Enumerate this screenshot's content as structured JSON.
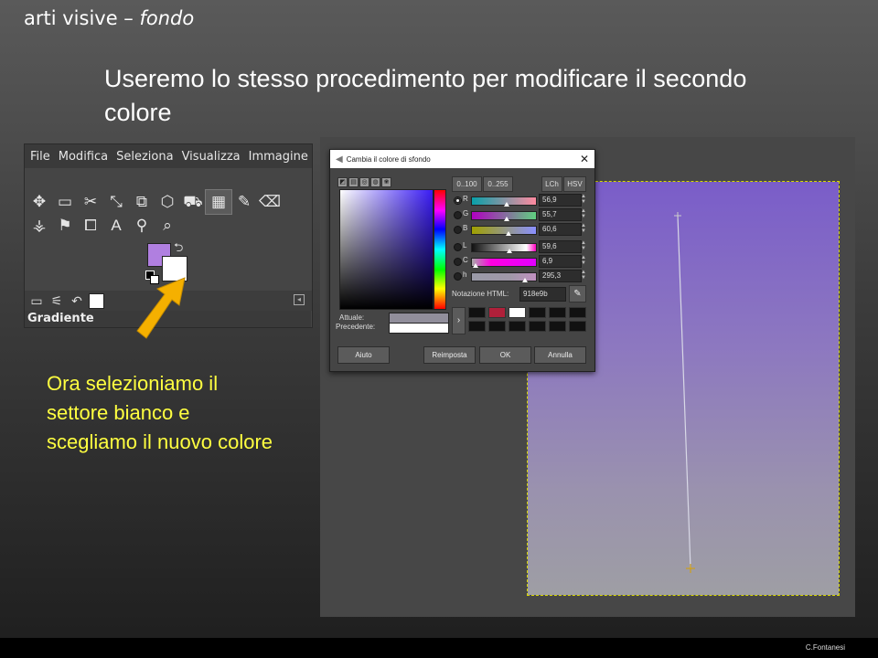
{
  "slide": {
    "title_main": "arti visive – ",
    "title_italic": "fondo",
    "heading": "Useremo lo stesso procedimento per modificare il secondo colore",
    "caption": "Ora selezioniamo il settore bianco e scegliamo il nuovo colore",
    "author": "C.Fontanesi"
  },
  "toolbox": {
    "menu": [
      "File",
      "Modifica",
      "Seleziona",
      "Visualizza",
      "Immagine"
    ],
    "tools": [
      "✥",
      "▭",
      "✂",
      "⤡",
      "⧉",
      "⬡",
      "⛟",
      "▦",
      "✎",
      "⌫",
      "⚶",
      "⚑",
      "⧠",
      "A",
      "⚲",
      "⌕"
    ],
    "fg_color": "#b07fe0",
    "bg_color": "#ffffff",
    "panel_title": "Gradiente"
  },
  "dialog": {
    "title": "Cambia il colore di sfondo",
    "scale": [
      "0..100",
      "0..255"
    ],
    "models": [
      "LCh",
      "HSV"
    ],
    "sliders": [
      {
        "label": "R",
        "value": "56,9"
      },
      {
        "label": "G",
        "value": "55,7"
      },
      {
        "label": "B",
        "value": "60,6"
      },
      {
        "label": "L",
        "value": "59,6"
      },
      {
        "label": "C",
        "value": "6,9"
      },
      {
        "label": "h",
        "value": "295,3"
      }
    ],
    "html_label": "Notazione HTML:",
    "html_value": "918e9b",
    "current_label": "Attuale:",
    "previous_label": "Precedente:",
    "current_color": "#918e9b",
    "previous_color": "#ffffff",
    "history_colors": [
      "#111111",
      "#b0203a",
      "#ffffff",
      "#111111",
      "#111111",
      "#111111",
      "#111111",
      "#111111",
      "#111111",
      "#111111",
      "#111111",
      "#111111"
    ],
    "buttons": {
      "help": "Aiuto",
      "reset": "Reimposta",
      "ok": "OK",
      "cancel": "Annulla"
    }
  }
}
